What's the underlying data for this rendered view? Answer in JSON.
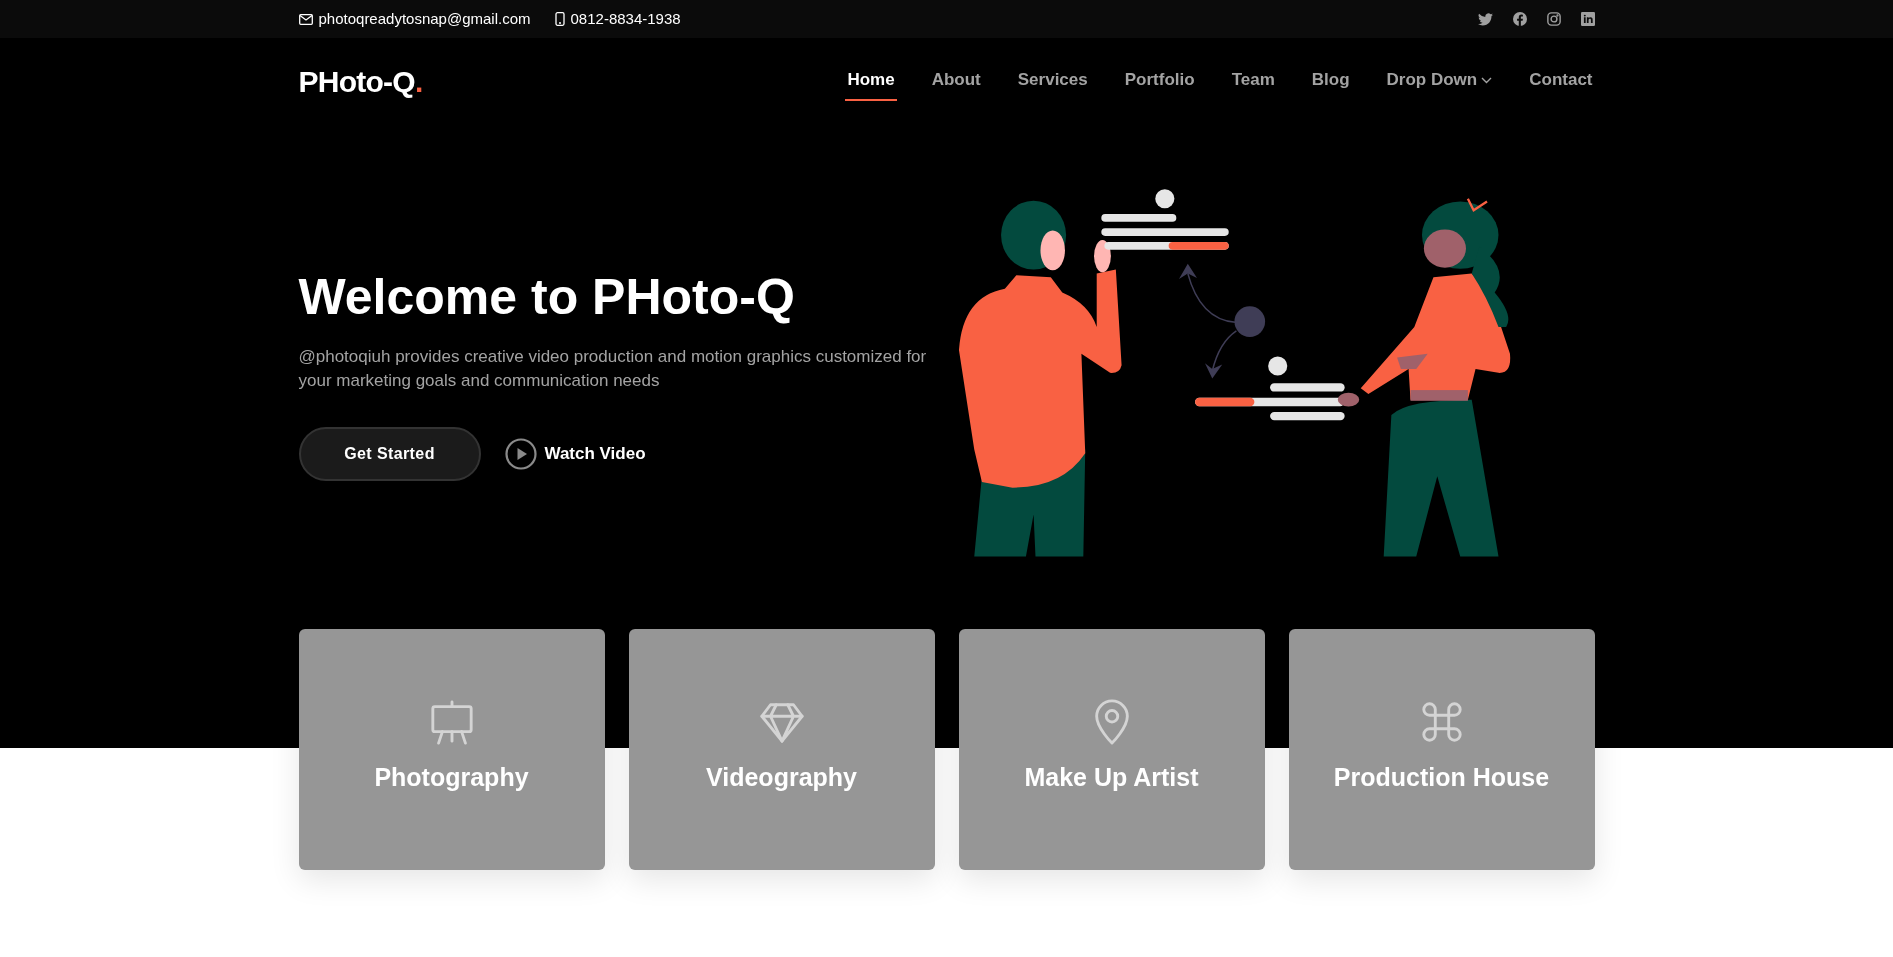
{
  "top_bar": {
    "email": "photoqreadytosnap@gmail.com",
    "phone": "0812-8834-1938"
  },
  "logo": {
    "text": "PHoto-Q",
    "accent": "."
  },
  "nav": [
    {
      "label": "Home",
      "selected": true,
      "has_dropdown": false
    },
    {
      "label": "About",
      "selected": false,
      "has_dropdown": false
    },
    {
      "label": "Services",
      "selected": false,
      "has_dropdown": false
    },
    {
      "label": "Portfolio",
      "selected": false,
      "has_dropdown": false
    },
    {
      "label": "Team",
      "selected": false,
      "has_dropdown": false
    },
    {
      "label": "Blog",
      "selected": false,
      "has_dropdown": false
    },
    {
      "label": "Drop Down",
      "selected": false,
      "has_dropdown": true
    },
    {
      "label": "Contact",
      "selected": false,
      "has_dropdown": false
    }
  ],
  "hero": {
    "title": "Welcome to PHoto-Q",
    "description": "@photoqiuh provides creative video production and motion graphics customized for your marketing goals and communication needs",
    "primary_button": "Get Started",
    "video_link": "Watch Video"
  },
  "services": [
    {
      "label": "Photography"
    },
    {
      "label": "Videography"
    },
    {
      "label": "Make Up Artist"
    },
    {
      "label": "Production House"
    }
  ]
}
